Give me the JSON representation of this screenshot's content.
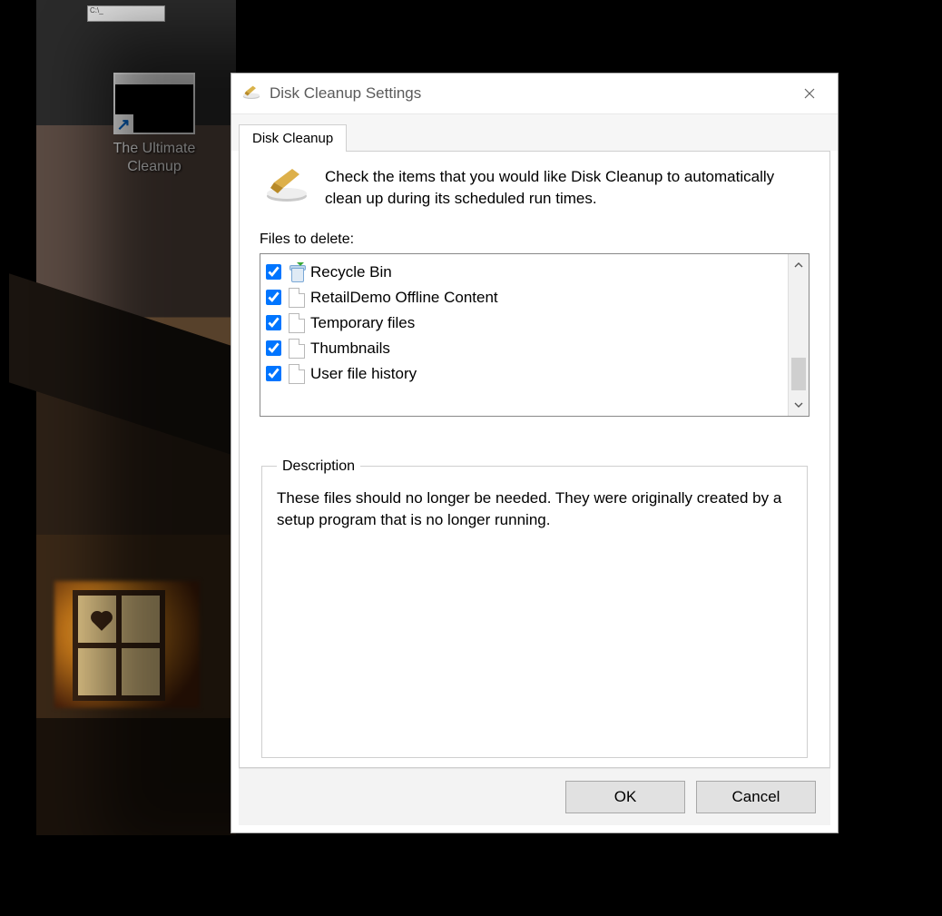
{
  "desktop": {
    "shortcut_label": "The Ultimate Cleanup"
  },
  "dialog": {
    "title": "Disk Cleanup Settings",
    "tab_label": "Disk Cleanup",
    "intro_text": "Check the items that you would like Disk Cleanup to automatically clean up during its scheduled run times.",
    "list_label": "Files to delete:",
    "items": [
      {
        "label": "Recycle Bin",
        "checked": true,
        "icon": "bin"
      },
      {
        "label": "RetailDemo Offline Content",
        "checked": true,
        "icon": "page"
      },
      {
        "label": "Temporary files",
        "checked": true,
        "icon": "page"
      },
      {
        "label": "Thumbnails",
        "checked": true,
        "icon": "page"
      },
      {
        "label": "User file history",
        "checked": true,
        "icon": "page"
      }
    ],
    "description_legend": "Description",
    "description_body": "These files should no longer be needed. They were originally created by a setup program that is no longer running.",
    "ok_label": "OK",
    "cancel_label": "Cancel"
  }
}
